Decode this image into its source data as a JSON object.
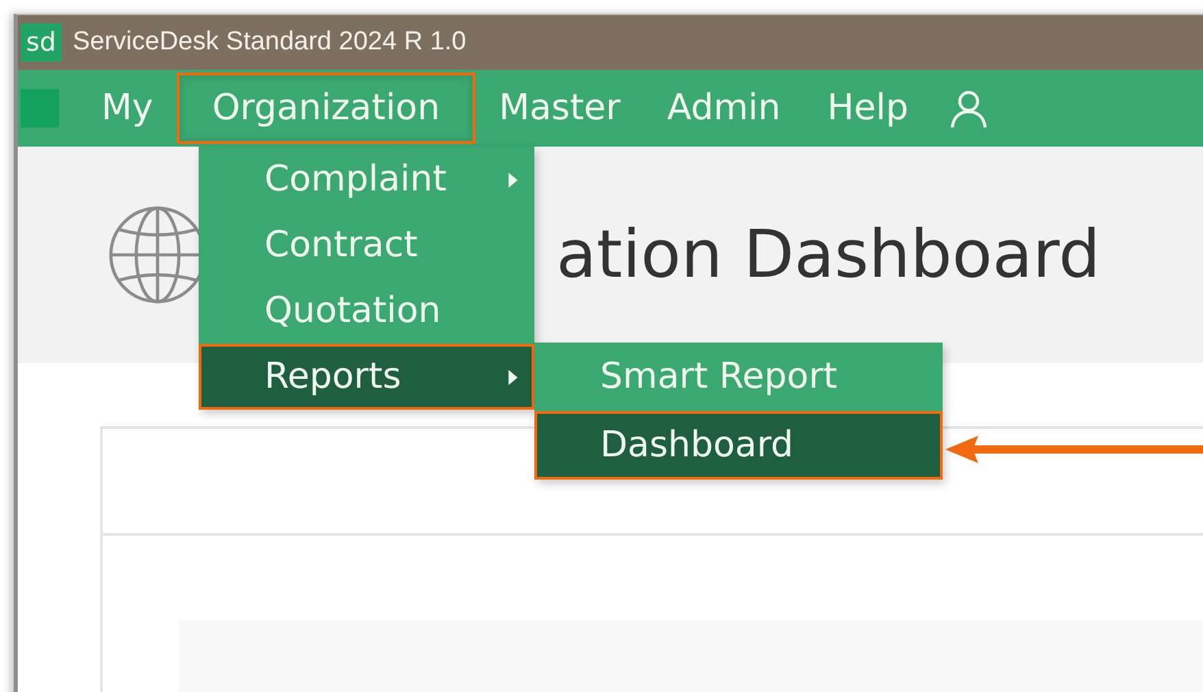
{
  "window": {
    "title": "ServiceDesk Standard 2024 R 1.0",
    "logo": "sd"
  },
  "menu_bar": {
    "items": [
      {
        "label": "My",
        "highlighted": false
      },
      {
        "label": "Organization",
        "highlighted": true
      },
      {
        "label": "Master",
        "highlighted": false
      },
      {
        "label": "Admin",
        "highlighted": false
      },
      {
        "label": "Help",
        "highlighted": false
      }
    ]
  },
  "dropdown": {
    "items": [
      {
        "label": "Complaint",
        "has_submenu": true,
        "selected": false,
        "highlighted": false
      },
      {
        "label": "Contract",
        "has_submenu": false,
        "selected": false,
        "highlighted": false
      },
      {
        "label": "Quotation",
        "has_submenu": false,
        "selected": false,
        "highlighted": false
      },
      {
        "label": "Reports",
        "has_submenu": true,
        "selected": true,
        "highlighted": true
      }
    ]
  },
  "submenu": {
    "items": [
      {
        "label": "Smart Report",
        "selected": false,
        "highlighted": false
      },
      {
        "label": "Dashboard",
        "selected": true,
        "highlighted": true
      }
    ]
  },
  "page": {
    "title": "ation Dashboard"
  },
  "annotation": {
    "arrow": true
  }
}
